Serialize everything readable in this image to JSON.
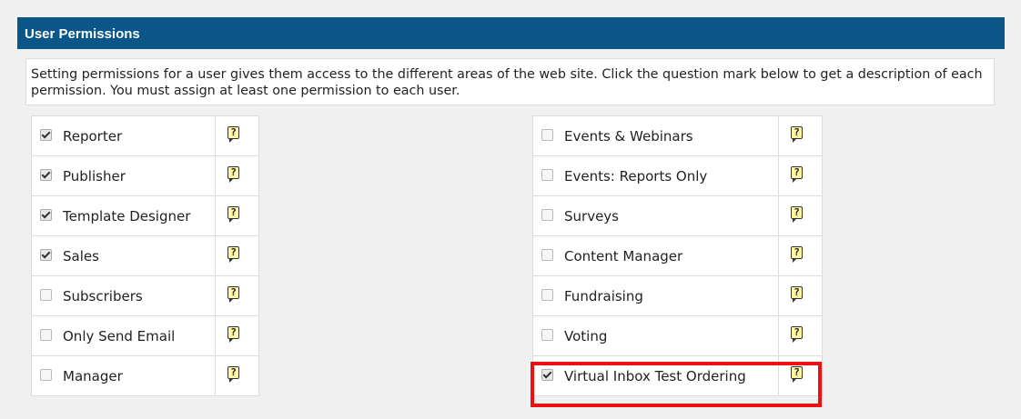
{
  "header": {
    "title": "User Permissions"
  },
  "intro": {
    "text": "Setting permissions for a user gives them access to the different areas of the web site. Click the question mark below to get a description of each permission. You must assign at least one permission to each user."
  },
  "help_icon_glyph": "?",
  "left_permissions": [
    {
      "label": "Reporter",
      "checked": true
    },
    {
      "label": "Publisher",
      "checked": true
    },
    {
      "label": "Template Designer",
      "checked": true
    },
    {
      "label": "Sales",
      "checked": true
    },
    {
      "label": "Subscribers",
      "checked": false
    },
    {
      "label": "Only Send Email",
      "checked": false
    },
    {
      "label": "Manager",
      "checked": false
    }
  ],
  "right_permissions": [
    {
      "label": "Events & Webinars",
      "checked": false
    },
    {
      "label": "Events: Reports Only",
      "checked": false
    },
    {
      "label": "Surveys",
      "checked": false
    },
    {
      "label": "Content Manager",
      "checked": false
    },
    {
      "label": "Fundraising",
      "checked": false
    },
    {
      "label": "Voting",
      "checked": false
    },
    {
      "label": "Virtual Inbox Test Ordering",
      "checked": true
    }
  ],
  "colors": {
    "header_bg": "#0b5689",
    "highlight": "#ee1111",
    "help_bg": "#fff9a6"
  }
}
